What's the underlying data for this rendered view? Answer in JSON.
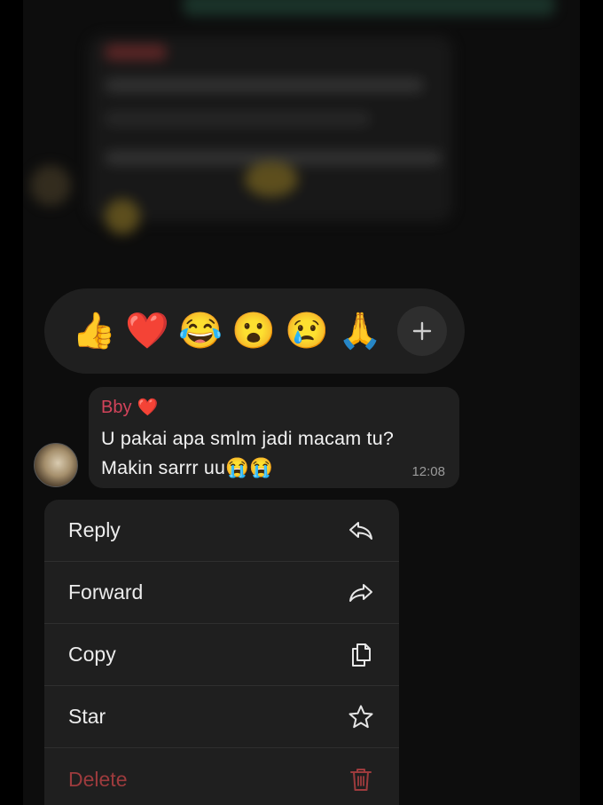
{
  "reactions": {
    "emojis": [
      "👍",
      "❤️",
      "😂",
      "😮",
      "😢",
      "🙏"
    ],
    "more_symbol": "+"
  },
  "message": {
    "sender": "Bby",
    "sender_emoji": "❤️",
    "line1": "U pakai apa smlm jadi macam tu?",
    "line2": "Makin sarrr uu😭😭",
    "time": "12:08"
  },
  "menu": {
    "items": [
      {
        "label": "Reply",
        "icon": "reply-icon"
      },
      {
        "label": "Forward",
        "icon": "forward-icon"
      },
      {
        "label": "Copy",
        "icon": "copy-icon"
      },
      {
        "label": "Star",
        "icon": "star-icon"
      },
      {
        "label": "Delete",
        "icon": "trash-icon"
      }
    ]
  },
  "colors": {
    "sender": "#d2435a",
    "delete": "#9d3b3d",
    "surface": "#1f1f1f"
  }
}
